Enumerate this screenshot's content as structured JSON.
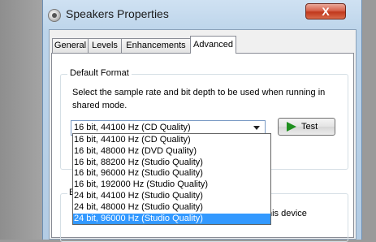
{
  "window": {
    "title": "Speakers Properties",
    "close_glyph": "X"
  },
  "tabs": [
    {
      "label": "General",
      "active": false
    },
    {
      "label": "Levels",
      "active": false
    },
    {
      "label": "Enhancements",
      "active": false
    },
    {
      "label": "Advanced",
      "active": true
    }
  ],
  "default_format": {
    "group_title": "Default Format",
    "description": "Select the sample rate and bit depth to be used when running in shared mode.",
    "selected_value": "16 bit, 44100 Hz (CD Quality)",
    "test_label": "Test",
    "options": [
      "16 bit, 44100 Hz (CD Quality)",
      "16 bit, 48000 Hz (DVD Quality)",
      "16 bit, 88200 Hz (Studio Quality)",
      "16 bit, 96000 Hz (Studio Quality)",
      "16 bit, 192000 Hz (Studio Quality)",
      "24 bit, 44100 Hz (Studio Quality)",
      "24 bit, 48000 Hz (Studio Quality)",
      "24 bit, 96000 Hz (Studio Quality)"
    ],
    "highlighted_option": "24 bit, 96000 Hz (Studio Quality)"
  },
  "exclusive_mode": {
    "group_title_partial": "E",
    "text_partial": "his device"
  },
  "colors": {
    "selection": "#3399ff",
    "close_button": "#c0381c",
    "play_icon": "#1f8f1f"
  }
}
